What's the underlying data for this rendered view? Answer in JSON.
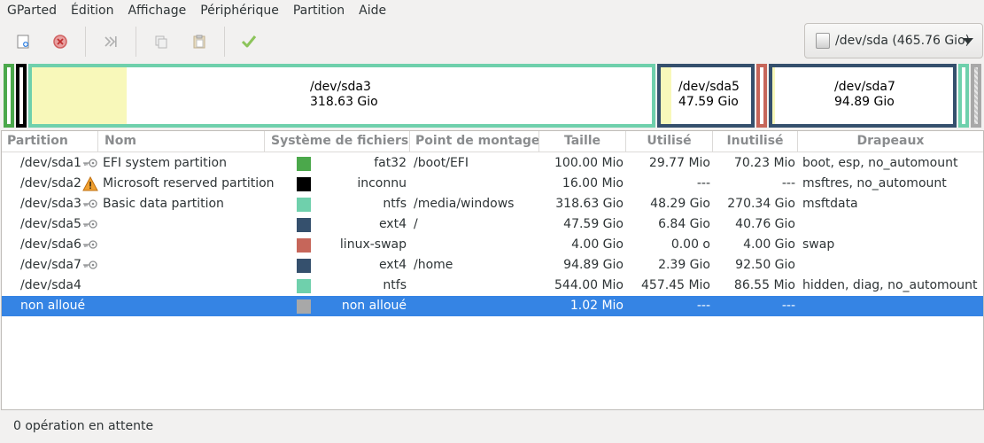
{
  "menu": [
    "GParted",
    "Édition",
    "Affichage",
    "Périphérique",
    "Partition",
    "Aide"
  ],
  "toolbar": {
    "buttons": [
      "new-icon",
      "delete-icon",
      "resize-move-icon",
      "copy-icon",
      "paste-icon",
      "apply-icon"
    ],
    "device": "/dev/sda (465.76 Gio)"
  },
  "diskmap": {
    "sda3": {
      "name": "/dev/sda3",
      "size": "318.63 Gio",
      "color": "#6fd0ac"
    },
    "sda5": {
      "name": "/dev/sda5",
      "size": "47.59 Gio",
      "color": "#35506d"
    },
    "sda7": {
      "name": "/dev/sda7",
      "size": "94.89 Gio",
      "color": "#35506d"
    }
  },
  "columns": [
    "Partition",
    "Nom",
    "Système de fichiers",
    "Point de montage",
    "Taille",
    "Utilisé",
    "Inutilisé",
    "Drapeaux"
  ],
  "rows": [
    {
      "partition": "/dev/sda1",
      "icon": "key-icon",
      "name": "EFI system partition",
      "fs_color": "#4ba84b",
      "fs": "fat32",
      "mount": "/boot/EFI",
      "size": "100.00 Mio",
      "used": "29.77 Mio",
      "unused": "70.23 Mio",
      "flags": "boot, esp, no_automount"
    },
    {
      "partition": "/dev/sda2",
      "icon": "warning-icon",
      "name": "Microsoft reserved partition",
      "fs_color": "#000000",
      "fs": "inconnu",
      "mount": "",
      "size": "16.00 Mio",
      "used": "---",
      "unused": "---",
      "flags": "msftres, no_automount"
    },
    {
      "partition": "/dev/sda3",
      "icon": "key-icon",
      "name": "Basic data partition",
      "fs_color": "#6fd0ac",
      "fs": "ntfs",
      "mount": "/media/windows",
      "size": "318.63 Gio",
      "used": "48.29 Gio",
      "unused": "270.34 Gio",
      "flags": "msftdata"
    },
    {
      "partition": "/dev/sda5",
      "icon": "key-icon",
      "name": "",
      "fs_color": "#35506d",
      "fs": "ext4",
      "mount": "/",
      "size": "47.59 Gio",
      "used": "6.84 Gio",
      "unused": "40.76 Gio",
      "flags": ""
    },
    {
      "partition": "/dev/sda6",
      "icon": "key-icon",
      "name": "",
      "fs_color": "#c6665a",
      "fs": "linux-swap",
      "mount": "",
      "size": "4.00 Gio",
      "used": "0.00 o",
      "unused": "4.00 Gio",
      "flags": "swap"
    },
    {
      "partition": "/dev/sda7",
      "icon": "key-icon",
      "name": "",
      "fs_color": "#35506d",
      "fs": "ext4",
      "mount": "/home",
      "size": "94.89 Gio",
      "used": "2.39 Gio",
      "unused": "92.50 Gio",
      "flags": ""
    },
    {
      "partition": "/dev/sda4",
      "icon": "",
      "name": "",
      "fs_color": "#6fd0ac",
      "fs": "ntfs",
      "mount": "",
      "size": "544.00 Mio",
      "used": "457.45 Mio",
      "unused": "86.55 Mio",
      "flags": "hidden, diag, no_automount"
    },
    {
      "partition": "non alloué",
      "icon": "",
      "name": "",
      "fs_color": "#a8a8a8",
      "fs": "non alloué",
      "mount": "",
      "size": "1.02 Mio",
      "used": "---",
      "unused": "---",
      "flags": "",
      "selected": true
    }
  ],
  "status": "0 opération en attente"
}
